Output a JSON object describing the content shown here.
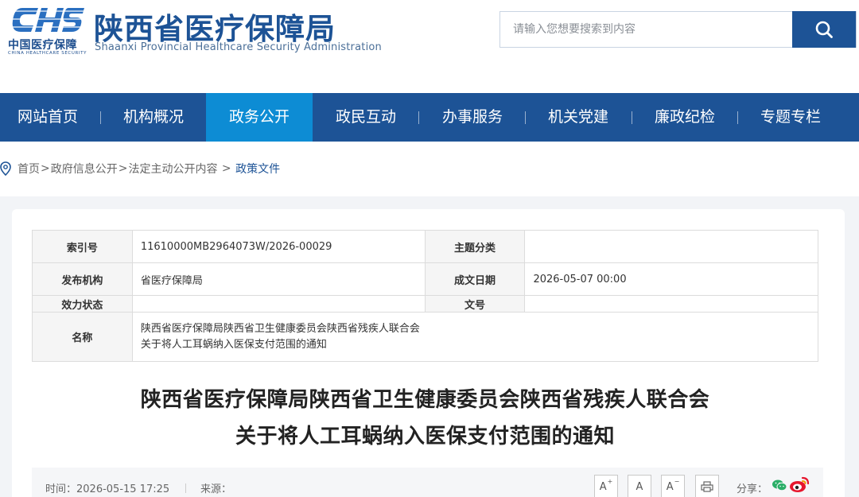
{
  "header": {
    "logo_cn": "中国医疗保障",
    "logo_en": "CHINA HEALTHCARE SECURITY",
    "title": "陕西省医疗保障局",
    "subtitle": "Shaanxi Provincial Healthcare Security Administration",
    "search_placeholder": "请输入您想要搜索到内容"
  },
  "nav": {
    "items": [
      {
        "label": "网站首页"
      },
      {
        "label": "机构概况"
      },
      {
        "label": "政务公开"
      },
      {
        "label": "政民互动"
      },
      {
        "label": "办事服务"
      },
      {
        "label": "机关党建"
      },
      {
        "label": "廉政纪检"
      },
      {
        "label": "专题专栏"
      }
    ],
    "active_index": 2
  },
  "breadcrumb": {
    "items": [
      "首页",
      "政府信息公开",
      "法定主动公开内容"
    ],
    "current": "政策文件"
  },
  "info_table": {
    "labels": {
      "index_no": "索引号",
      "category": "主题分类",
      "issuer": "发布机构",
      "date": "成文日期",
      "status": "效力状态",
      "doc_no": "文号",
      "name": "名称"
    },
    "values": {
      "index_no": "11610000MB2964073W/2026-00029",
      "category": "",
      "issuer": "省医疗保障局",
      "date": "2026-05-07 00:00",
      "status": "",
      "doc_no": "",
      "name_line1": "陕西省医疗保障局陕西省卫生健康委员会陕西省残疾人联合会",
      "name_line2": "关于将人工耳蜗纳入医保支付范围的通知"
    }
  },
  "document": {
    "title_line1": "陕西省医疗保障局陕西省卫生健康委员会陕西省残疾人联合会",
    "title_line2": "关于将人工耳蜗纳入医保支付范围的通知"
  },
  "meta": {
    "time": "时间：2026-05-15 17:25",
    "source": "来源：",
    "font_larger": "A",
    "font_normal": "A",
    "font_smaller": "A",
    "share_label": "分享："
  },
  "colors": {
    "brand": "#1d5396",
    "nav_active": "#0d8cd4"
  }
}
